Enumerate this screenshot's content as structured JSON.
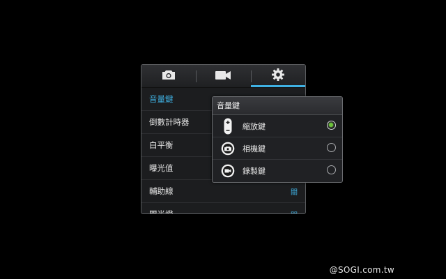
{
  "tabs": [
    {
      "name": "camera",
      "icon": "camera-icon"
    },
    {
      "name": "video",
      "icon": "video-camera-icon"
    },
    {
      "name": "settings",
      "icon": "gear-icon",
      "active": true
    }
  ],
  "settings": [
    {
      "label": "音量鍵",
      "value": "",
      "selected": true
    },
    {
      "label": "倒數計時器",
      "value": ""
    },
    {
      "label": "白平衡",
      "value": ""
    },
    {
      "label": "曝光值",
      "value": ""
    },
    {
      "label": "輔助線",
      "value": "關"
    },
    {
      "label": "閃光燈",
      "value": "關"
    }
  ],
  "popup": {
    "title": "音量鍵",
    "options": [
      {
        "label": "縮放鍵",
        "icon": "zoom-key-icon",
        "selected": true
      },
      {
        "label": "相機鍵",
        "icon": "camera-key-icon",
        "selected": false
      },
      {
        "label": "錄製鍵",
        "icon": "record-key-icon",
        "selected": false
      }
    ]
  },
  "watermark": "@SOGI.com.tw",
  "colors": {
    "accent": "#3fb1e3",
    "radio_on": "#6cc23a",
    "background": "#000000"
  }
}
